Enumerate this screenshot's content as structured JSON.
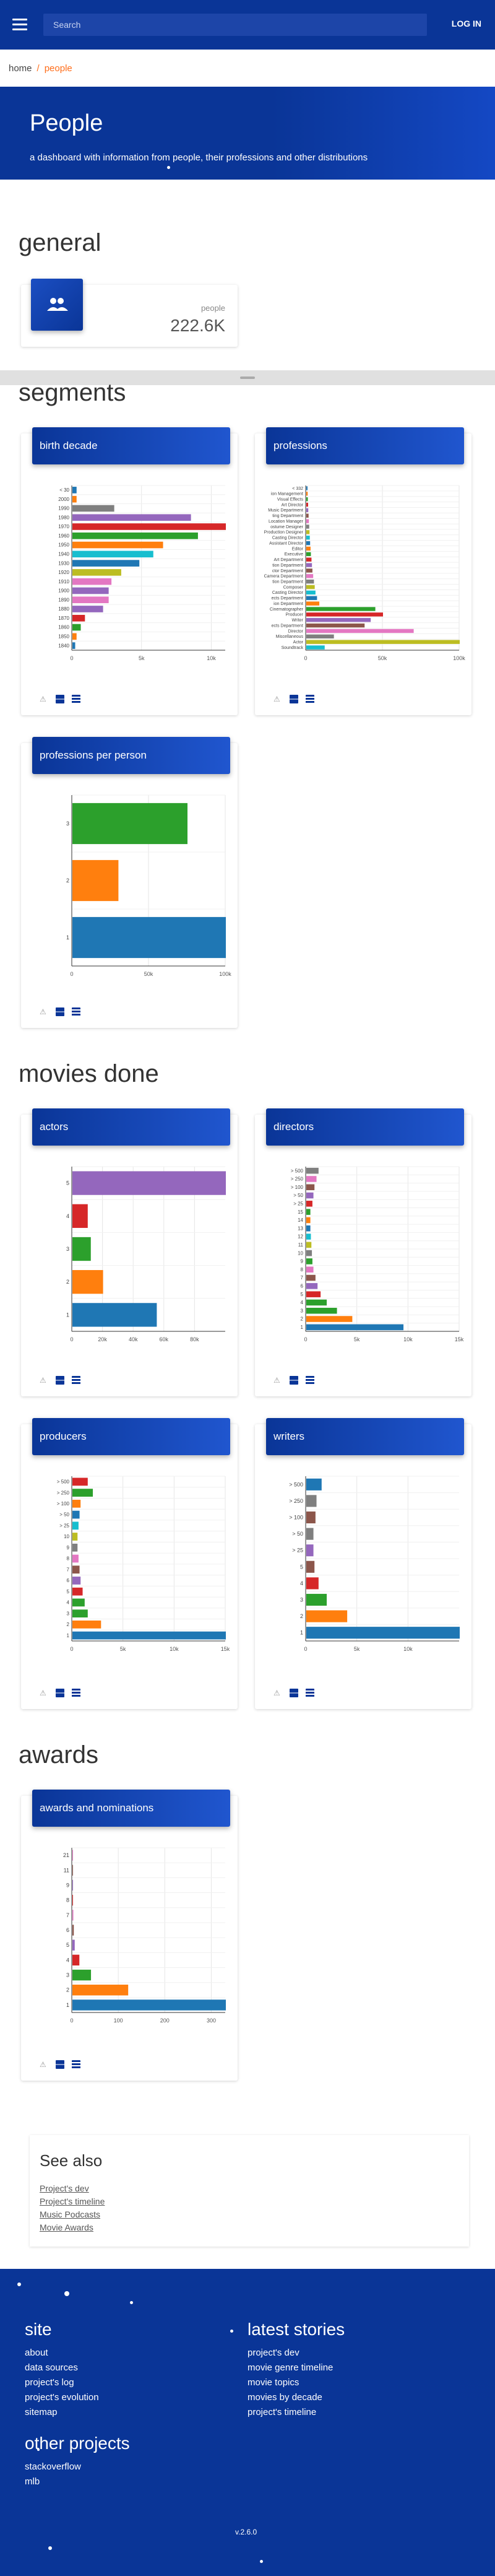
{
  "header": {
    "search_placeholder": "Search",
    "login_label": "LOG IN"
  },
  "breadcrumb": {
    "home": "home",
    "separator": "/",
    "current": "people"
  },
  "hero": {
    "title": "People",
    "subtitle": "a dashboard with information from people, their professions and other distributions"
  },
  "sections": {
    "general": "general",
    "segments": "segments",
    "movies_done": "movies done",
    "awards": "awards"
  },
  "stat": {
    "label": "people",
    "value": "222.6K",
    "icon": "people-icon"
  },
  "charts": {
    "birth_decade": {
      "title": "birth decade",
      "chart_data": {
        "type": "bar",
        "orientation": "horizontal",
        "categories": [
          "< 30",
          "2000",
          "1990",
          "1980",
          "1970",
          "1960",
          "1950",
          "1940",
          "1930",
          "1920",
          "1910",
          "1900",
          "1890",
          "1880",
          "1870",
          "1860",
          "1850",
          "1840"
        ],
        "values": [
          300,
          300,
          3000,
          8500,
          11000,
          9000,
          6500,
          5800,
          4800,
          3500,
          2800,
          2600,
          2600,
          2200,
          900,
          600,
          300,
          200
        ],
        "colors": [
          "#1f77b4",
          "#ff7f0e",
          "#7f7f7f",
          "#9467bd",
          "#d62728",
          "#2ca02c",
          "#ff7f0e",
          "#17becf",
          "#1f77b4",
          "#bcbd22",
          "#e377c2",
          "#9467bd",
          "#e377c2",
          "#9467bd",
          "#d62728",
          "#2ca02c",
          "#ff7f0e",
          "#1f77b4"
        ],
        "x_ticks": [
          "0",
          "5k",
          "10k"
        ],
        "xlim": [
          0,
          11000
        ]
      }
    },
    "professions": {
      "title": "professions",
      "chart_data": {
        "type": "bar",
        "orientation": "horizontal",
        "categories": [
          "< 332",
          "ion Management",
          "Visual Effects",
          "Art Director",
          "Music Department",
          "ting Department",
          "Location Manager",
          "ostume Designer",
          "Production Designer",
          "Casting Director",
          "Assistant Director",
          "Editor",
          "Executive",
          "Art Department",
          "tion Department",
          "ctor Department",
          "Camera Department",
          "tion Department",
          "Composer",
          "Casting Director",
          "ects Department",
          "ion Department",
          "Cinematographer",
          "Producer",
          "Writer",
          "ects Department",
          "Director",
          "Miscellaneous",
          "Actor",
          "Soundtrack"
        ],
        "values": [
          800,
          900,
          1000,
          1200,
          1300,
          1500,
          1700,
          1900,
          2100,
          2300,
          2500,
          2800,
          3000,
          3400,
          3700,
          4000,
          4500,
          5000,
          5500,
          6000,
          7000,
          8500,
          45000,
          50000,
          42000,
          38000,
          70000,
          18000,
          100000,
          12000
        ],
        "x_ticks": [
          "0",
          "50k",
          "100k"
        ],
        "xlim": [
          0,
          100000
        ]
      }
    },
    "professions_per_person": {
      "title": "professions per person",
      "chart_data": {
        "type": "bar",
        "orientation": "horizontal",
        "categories": [
          "3",
          "2",
          "1"
        ],
        "values": [
          75000,
          30000,
          100000
        ],
        "colors": [
          "#2ca02c",
          "#ff7f0e",
          "#1f77b4"
        ],
        "x_ticks": [
          "0",
          "50k",
          "100k"
        ],
        "xlim": [
          0,
          100000
        ]
      }
    },
    "actors": {
      "title": "actors",
      "chart_data": {
        "type": "bar",
        "orientation": "horizontal",
        "categories": [
          "5",
          "4",
          "3",
          "2",
          "1"
        ],
        "values": [
          100000,
          10000,
          12000,
          20000,
          55000
        ],
        "colors": [
          "#9467bd",
          "#d62728",
          "#2ca02c",
          "#ff7f0e",
          "#1f77b4"
        ],
        "x_ticks": [
          "0",
          "20k",
          "40k",
          "60k",
          "80k"
        ],
        "xlim": [
          0,
          100000
        ]
      }
    },
    "directors": {
      "title": "directors",
      "chart_data": {
        "type": "bar",
        "orientation": "horizontal",
        "categories": [
          "> 500",
          "> 250",
          "> 100",
          "> 50",
          "> 25",
          "15",
          "14",
          "13",
          "12",
          "11",
          "10",
          "9",
          "8",
          "7",
          "6",
          "5",
          "4",
          "3",
          "2",
          "1"
        ],
        "values": [
          1200,
          1000,
          800,
          700,
          600,
          400,
          400,
          400,
          450,
          500,
          550,
          600,
          700,
          900,
          1100,
          1400,
          2000,
          3000,
          4500,
          9500
        ],
        "colors": [
          "#7f7f7f",
          "#e377c2",
          "#8c564b",
          "#9467bd",
          "#d62728",
          "#2ca02c",
          "#ff7f0e",
          "#1f77b4",
          "#17becf",
          "#bcbd22",
          "#7f7f7f",
          "#2ca02c",
          "#e377c2",
          "#8c564b",
          "#9467bd",
          "#d62728",
          "#2ca02c",
          "#2ca02c",
          "#ff7f0e",
          "#1f77b4"
        ],
        "x_ticks": [
          "0",
          "5k",
          "10k",
          "15k"
        ],
        "xlim": [
          0,
          15000
        ]
      }
    },
    "producers": {
      "title": "producers",
      "chart_data": {
        "type": "bar",
        "orientation": "horizontal",
        "categories": [
          "> 500",
          "> 250",
          "> 100",
          "> 50",
          "> 25",
          "10",
          "9",
          "8",
          "7",
          "6",
          "5",
          "4",
          "3",
          "2",
          "1"
        ],
        "values": [
          1500,
          2000,
          800,
          700,
          600,
          500,
          500,
          600,
          700,
          800,
          1000,
          1200,
          1500,
          2800,
          15000
        ],
        "colors": [
          "#d62728",
          "#2ca02c",
          "#ff7f0e",
          "#1f77b4",
          "#17becf",
          "#bcbd22",
          "#7f7f7f",
          "#e377c2",
          "#8c564b",
          "#9467bd",
          "#d62728",
          "#2ca02c",
          "#2ca02c",
          "#ff7f0e",
          "#1f77b4"
        ],
        "x_ticks": [
          "0",
          "5k",
          "10k",
          "15k"
        ],
        "xlim": [
          0,
          15000
        ]
      }
    },
    "writers": {
      "title": "writers",
      "chart_data": {
        "type": "bar",
        "orientation": "horizontal",
        "categories": [
          "> 500",
          "> 250",
          "> 100",
          "> 50",
          "> 25",
          "5",
          "4",
          "3",
          "2",
          "1"
        ],
        "values": [
          1500,
          1000,
          900,
          700,
          700,
          800,
          1200,
          2000,
          4000,
          15000
        ],
        "colors": [
          "#1f77b4",
          "#7f7f7f",
          "#8c564b",
          "#7f7f7f",
          "#9467bd",
          "#8c564b",
          "#d62728",
          "#2ca02c",
          "#ff7f0e",
          "#1f77b4"
        ],
        "x_ticks": [
          "0",
          "5k",
          "10k"
        ],
        "xlim": [
          0,
          15000
        ]
      }
    },
    "awards_and_nominations": {
      "title": "awards and nominations",
      "chart_data": {
        "type": "bar",
        "orientation": "horizontal",
        "categories": [
          "21",
          "11",
          "9",
          "8",
          "7",
          "6",
          "5",
          "4",
          "3",
          "2",
          "1"
        ],
        "values": [
          1,
          1,
          1,
          1,
          2,
          3,
          5,
          15,
          40,
          120,
          330
        ],
        "colors": [
          "#e377c2",
          "#8c564b",
          "#9467bd",
          "#d62728",
          "#e377c2",
          "#8c564b",
          "#9467bd",
          "#d62728",
          "#2ca02c",
          "#ff7f0e",
          "#1f77b4"
        ],
        "x_ticks": [
          "0",
          "100",
          "200",
          "300"
        ],
        "xlim": [
          0,
          330
        ]
      }
    }
  },
  "see_also": {
    "title": "See also",
    "links": [
      "Project's dev",
      "Project's timeline",
      "Music Podcasts",
      "Movie Awards"
    ]
  },
  "footer": {
    "site_title": "site",
    "site_links": [
      "about",
      "data sources",
      "project's log",
      "project's evolution",
      "sitemap"
    ],
    "stories_title": "latest stories",
    "stories_links": [
      "project's dev",
      "movie genre timeline",
      "movie topics",
      "movies by decade",
      "project's timeline"
    ],
    "other_title": "other projects",
    "other_links": [
      "stackoverflow",
      "mlb"
    ],
    "version": "v.2.6.0"
  },
  "colors": {
    "brand": "#0a3597",
    "accent": "#ff6e1b"
  }
}
